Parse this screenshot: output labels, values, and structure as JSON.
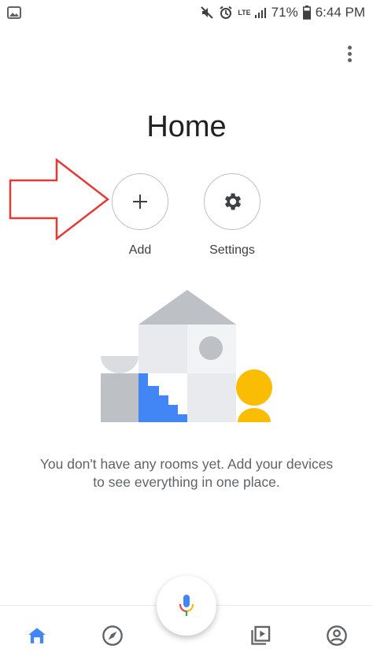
{
  "status_bar": {
    "network": "LTE",
    "battery_percent": "71%",
    "time": "6:44 PM",
    "icons": [
      "image-icon",
      "mute-icon",
      "alarm-icon",
      "signal-icon",
      "battery-icon"
    ]
  },
  "header": {
    "menu_icon": "more-vert-icon"
  },
  "page": {
    "title": "Home"
  },
  "actions": {
    "add_label": "Add",
    "settings_label": "Settings"
  },
  "empty_state": {
    "message_line1": "You don't have any rooms yet. Add your devices",
    "message_line2": "to see everything in one place."
  },
  "bottom_nav": {
    "items": [
      "home-icon",
      "discover-icon",
      "mic-icon",
      "media-icon",
      "account-icon"
    ],
    "active": "home-icon"
  },
  "colors": {
    "accent_blue": "#4285f4",
    "annotation_red": "#e53935",
    "mic_red": "#ea4335",
    "mic_yellow": "#fbbc04",
    "illustration_yellow": "#fbbc04"
  }
}
